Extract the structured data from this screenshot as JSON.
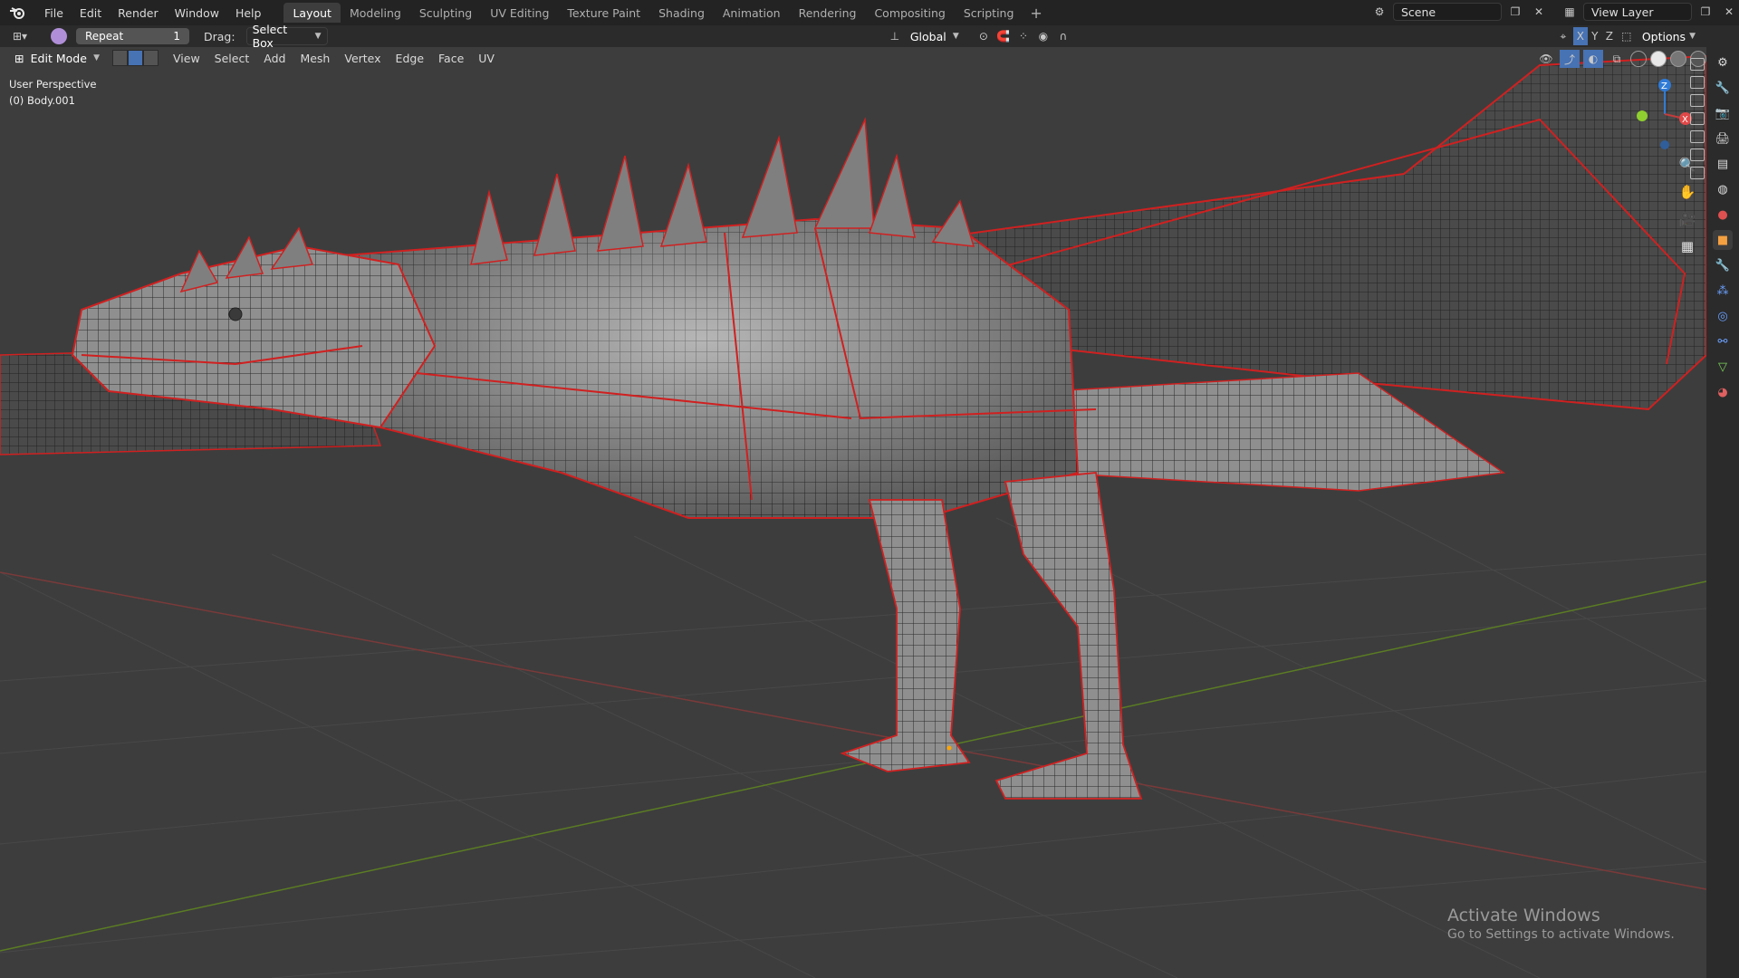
{
  "menu": [
    "File",
    "Edit",
    "Render",
    "Window",
    "Help"
  ],
  "workspaces": [
    "Layout",
    "Modeling",
    "Sculpting",
    "UV Editing",
    "Texture Paint",
    "Shading",
    "Animation",
    "Rendering",
    "Compositing",
    "Scripting"
  ],
  "active_workspace": "Layout",
  "scene": {
    "name": "Scene",
    "view_layer": "View Layer"
  },
  "tool_header": {
    "repeat_label": "Repeat",
    "repeat_value": "1",
    "drag_label": "Drag:",
    "drag_value": "Select Box",
    "orientation": "Global",
    "options_label": "Options",
    "axes": [
      "X",
      "Y",
      "Z"
    ]
  },
  "view_header": {
    "mode": "Edit Mode",
    "menus": [
      "View",
      "Select",
      "Add",
      "Mesh",
      "Vertex",
      "Edge",
      "Face",
      "UV"
    ]
  },
  "viewport": {
    "perspective_label": "User Perspective",
    "object_label": "(0) Body.001",
    "gizmo_axes": {
      "z": "Z",
      "x": "X"
    }
  },
  "watermark": {
    "title": "Activate Windows",
    "subtitle": "Go to Settings to activate Windows."
  },
  "colors": {
    "accent": "#4772b3",
    "seam": "#e01f1f",
    "x_axis": "#c43c3c",
    "y_axis": "#6b9a1f",
    "z_axis": "#2f7bd6"
  }
}
